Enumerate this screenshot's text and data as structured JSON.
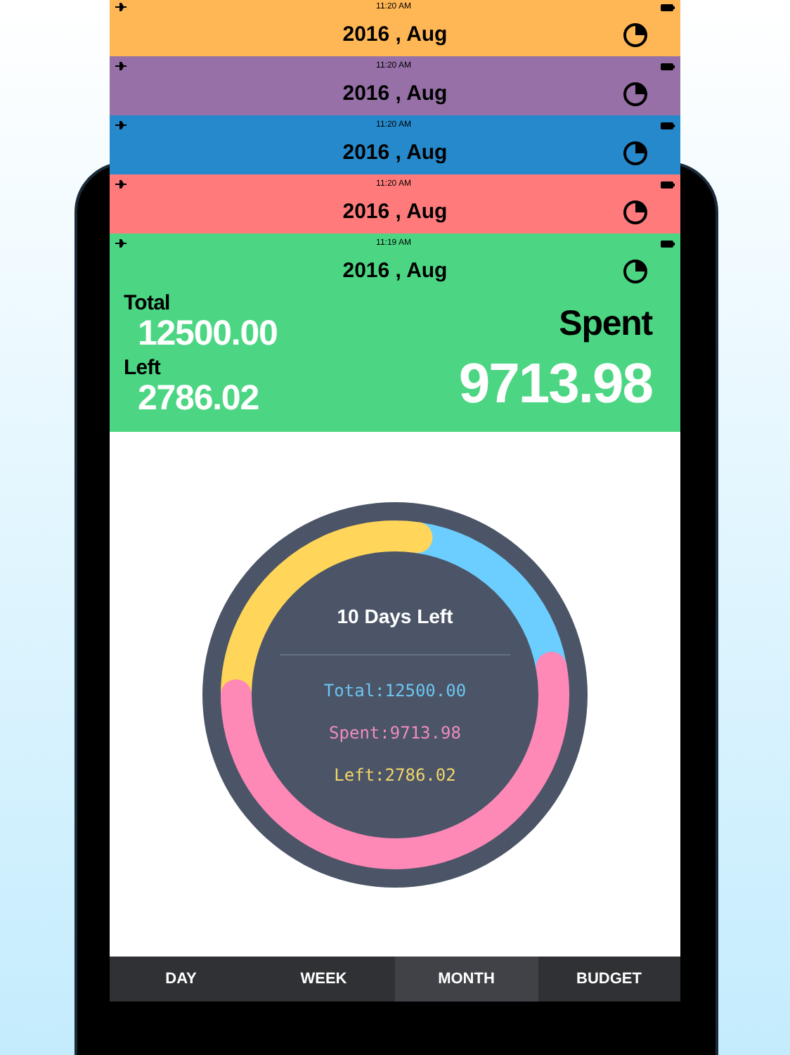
{
  "sheets": [
    {
      "color": "#ffb655",
      "time": "11:20 AM",
      "title": "2016 , Aug"
    },
    {
      "color": "#9670a6",
      "time": "11:20 AM",
      "title": "2016 , Aug"
    },
    {
      "color": "#2589cc",
      "time": "11:20 AM",
      "title": "2016 , Aug"
    },
    {
      "color": "#ff7b7b",
      "time": "11:20 AM",
      "title": "2016 , Aug"
    },
    {
      "color": "#4cd683",
      "time": "11:19 AM",
      "title": "2016 , Aug"
    }
  ],
  "summary": {
    "total_label": "Total",
    "total_value": "12500.00",
    "left_label": "Left",
    "left_value": "2786.02",
    "spent_label": "Spent",
    "spent_value": "9713.98"
  },
  "ring": {
    "days_left": "10 Days Left",
    "total": "Total:12500.00",
    "spent": "Spent:9713.98",
    "left": "Left:2786.02"
  },
  "tabs": [
    {
      "label": "DAY",
      "selected": false
    },
    {
      "label": "WEEK",
      "selected": false
    },
    {
      "label": "MONTH",
      "selected": true
    },
    {
      "label": "BUDGET",
      "selected": false
    }
  ]
}
